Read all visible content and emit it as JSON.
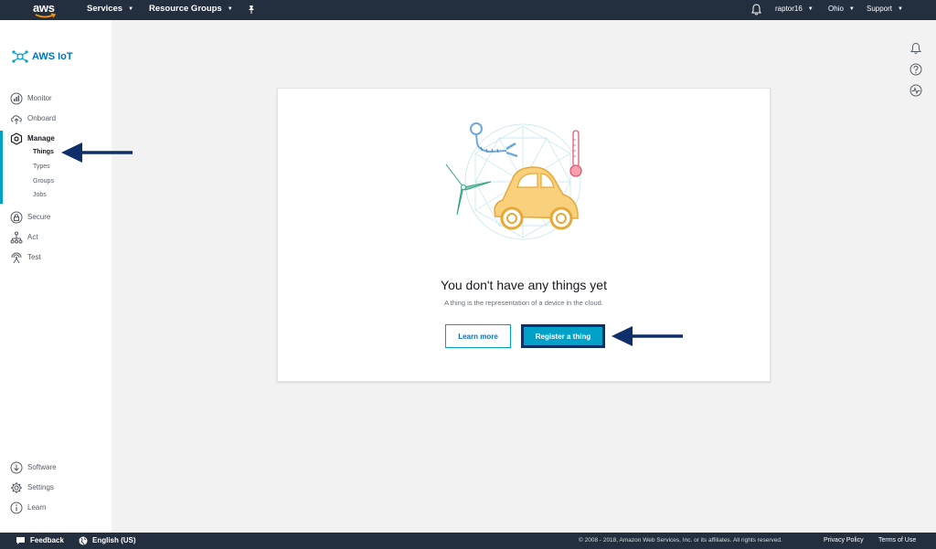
{
  "topnav": {
    "logo": "aws",
    "services": "Services",
    "resource_groups": "Resource Groups",
    "pin_icon": "pin-icon",
    "bell_icon": "bell-icon",
    "user": "raptor16",
    "region": "Ohio",
    "support": "Support"
  },
  "sidebar": {
    "brand": "AWS IoT",
    "items": [
      {
        "label": "Monitor",
        "icon": "monitor-icon"
      },
      {
        "label": "Onboard",
        "icon": "cloud-upload-icon"
      },
      {
        "label": "Manage",
        "icon": "manage-icon"
      },
      {
        "label": "Secure",
        "icon": "lock-icon"
      },
      {
        "label": "Act",
        "icon": "act-icon"
      },
      {
        "label": "Test",
        "icon": "test-icon"
      }
    ],
    "manage_sub": [
      "Things",
      "Types",
      "Groups",
      "Jobs"
    ],
    "bottom_items": [
      {
        "label": "Software",
        "icon": "download-icon"
      },
      {
        "label": "Settings",
        "icon": "gear-icon"
      },
      {
        "label": "Learn",
        "icon": "info-icon"
      }
    ]
  },
  "main": {
    "title": "You don't have any things yet",
    "subtitle": "A thing is the representation of a device in the cloud.",
    "learn_more": "Learn more",
    "register": "Register a thing"
  },
  "right_icons": [
    "bell-icon",
    "help-icon",
    "activity-icon"
  ],
  "footer": {
    "feedback": "Feedback",
    "language": "English (US)",
    "copyright": "© 2008 - 2018, Amazon Web Services, Inc. or its affiliates. All rights reserved.",
    "privacy": "Privacy Policy",
    "terms": "Terms of Use"
  },
  "colors": {
    "nav_bg": "#232f3e",
    "accent": "#00a1c9",
    "arrow": "#0f2f6b"
  }
}
